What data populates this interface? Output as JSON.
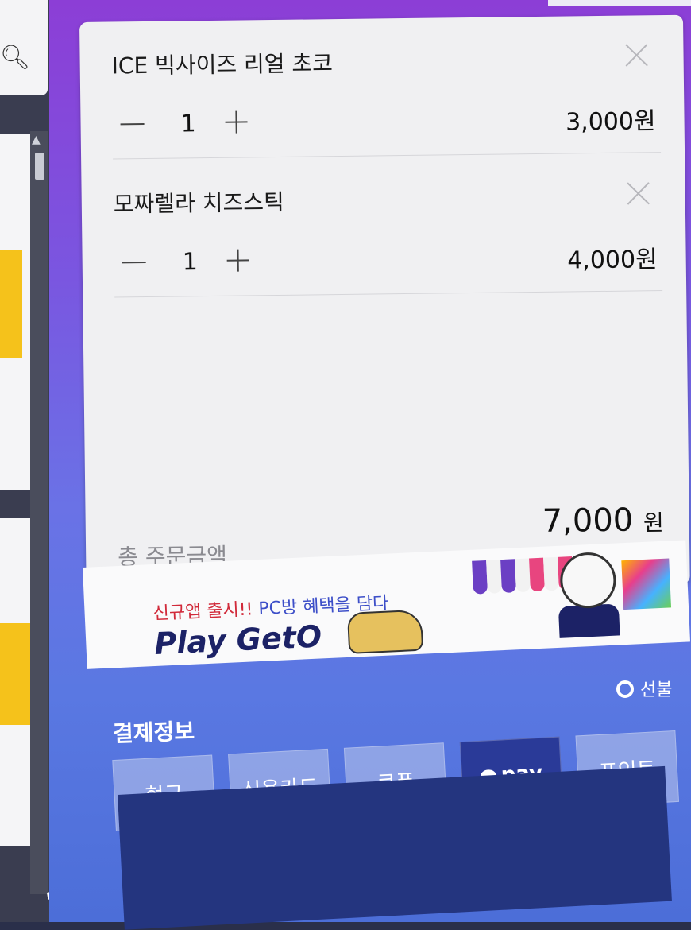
{
  "cart": {
    "items": [
      {
        "name": "ICE 빅사이즈 리얼 초코",
        "quantity": "1",
        "price": "3,000원"
      },
      {
        "name": "모짜렐라 치즈스틱",
        "quantity": "1",
        "price": "4,000원"
      }
    ],
    "total_label": "총 주문금액",
    "total_value": "7,000",
    "total_unit": "원"
  },
  "banner": {
    "subtitle_red": "신규앱 출시!!",
    "subtitle_blue": "PC방",
    "subtitle_rest": "혜택을 담다",
    "title": "Play GetO"
  },
  "payment": {
    "prepay_label": "선불",
    "section_title": "결제정보",
    "methods": [
      "현금",
      "신용카드",
      "쿠폰",
      "pay",
      "포인트"
    ]
  },
  "colors": {
    "panel_gradient_top": "#8c3ed6",
    "panel_gradient_bottom": "#4c6ed8",
    "accent_red": "#d12a3a",
    "brand_navy": "#1c2266",
    "pay_button_dark": "#2a3a98"
  },
  "icons": {
    "search": "search-icon",
    "scroll_up": "chevron-up-icon",
    "cursor": "mouse-cursor-icon",
    "remove": "close-icon",
    "minus": "minus-icon",
    "plus": "plus-icon",
    "chat": "speech-bubble-icon"
  }
}
